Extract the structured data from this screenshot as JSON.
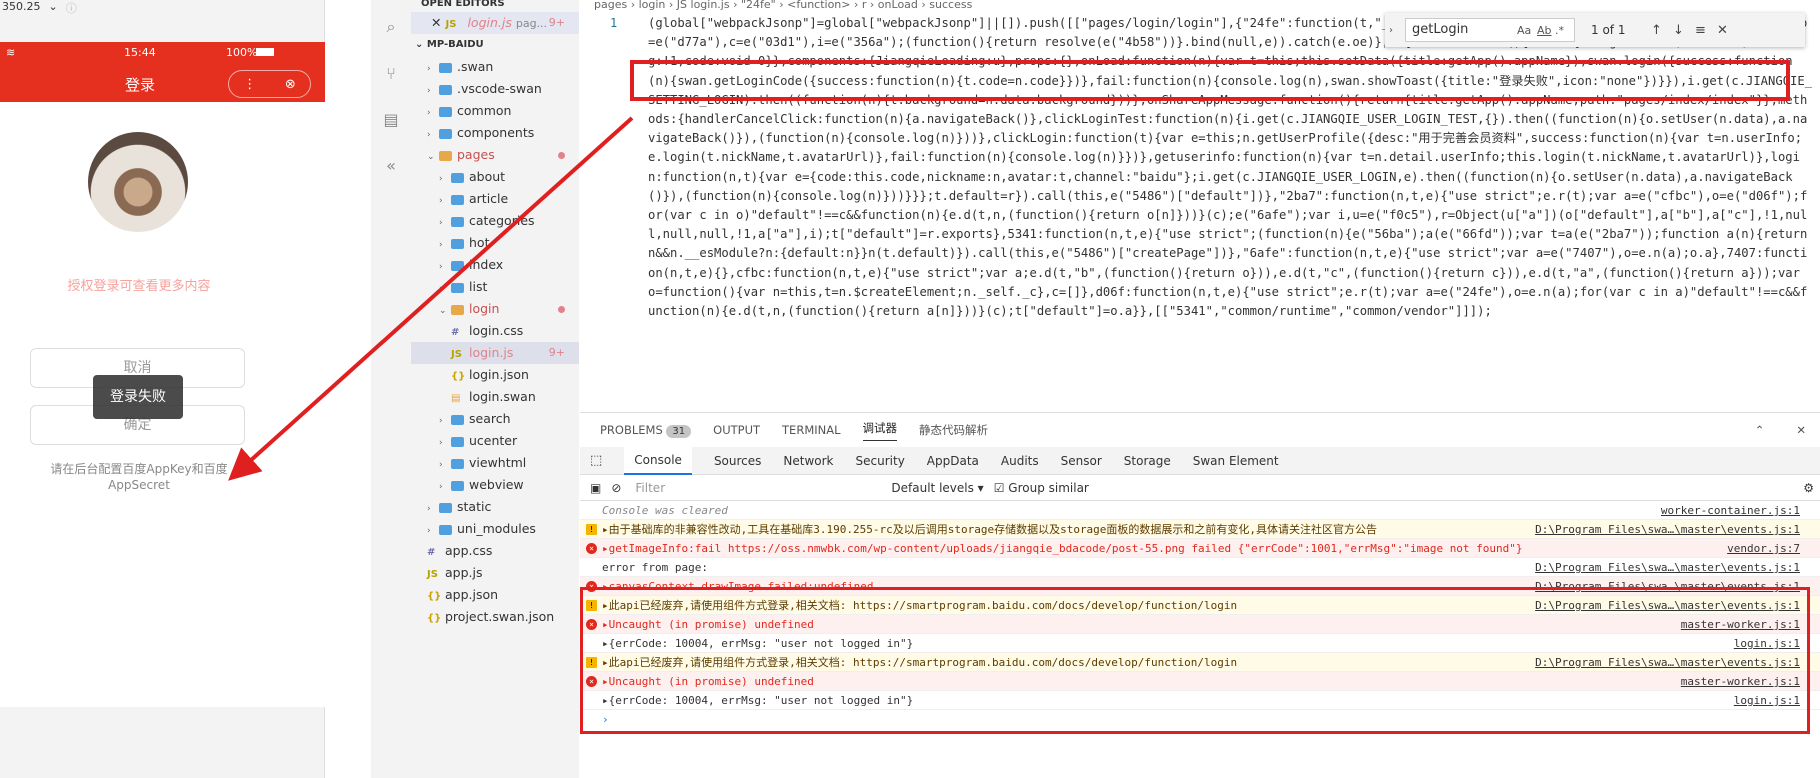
{
  "simulator": {
    "zoom": "350.25",
    "status_time": "15:44",
    "battery": "100%",
    "nav_title": "登录",
    "hint": "授权登录可查看更多内容",
    "cancel_label": "取消",
    "confirm_label": "确定",
    "toast": "登录失败",
    "footer": "请在后台配置百度AppKey和百度AppSecret"
  },
  "explorer": {
    "open_editors_label": "OPEN EDITORS",
    "open_file": "login.js",
    "open_file_path": "pag...",
    "open_file_badge": "9+",
    "project": "MP-BAIDU",
    "items": [
      ".swan",
      ".vscode-swan",
      "common",
      "components",
      "pages",
      "about",
      "article",
      "categories",
      "hot",
      "index",
      "list",
      "login",
      "login.css",
      "login.js",
      "login.json",
      "login.swan",
      "search",
      "ucenter",
      "viewhtml",
      "webview",
      "static",
      "uni_modules",
      "app.css",
      "app.js",
      "app.json",
      "project.swan.json"
    ],
    "login_js_badge": "9+"
  },
  "editor": {
    "breadcrumb": "pages › login › JS login.js › \"24fe\" › <function> › r › onLoad › success",
    "line_number": "1",
    "code": "(global[\"webpackJsonp\"]=global[\"webpackJsonp\"]||[]).push([[\"pages/login/login\"],{\"24fe\":function(t,\"__esModule\",{value:!0}),t.default=void 0;var a=e(\"a81a\"),o=e(\"d77a\"),c=e(\"03d1\"),i=e(\"356a\");(function(){return resolve(e(\"4b58\"))}.bind(null,e)).catch(e.oe)},r={data:function(){return{background:\"\",title:\"\",loading:!1,code:void 0}},components:{JiangqieLoading:u},props:{},onLoad:function(n){var t=this;this.setData({title:getApp().appName}),swan.login({success:function(n){swan.getLoginCode({success:function(n){t.code=n.code}})},fail:function(n){console.log(n),swan.showToast({title:\"登录失败\",icon:\"none\"})}}),i.get(c.JIANGQIE_SETTING_LOGIN).then((function(n){t.background=n.data.background}))},onShareAppMessage:function(){return{title:getApp().appName,path:\"pages/index/index\"}},methods:{handlerCancelClick:function(n){a.navigateBack()},clickLoginTest:function(n){i.get(c.JIANGQIE_USER_LOGIN_TEST,{}).then((function(n){o.setUser(n.data),a.navigateBack()}),(function(n){console.log(n)}))},clickLogin:function(t){var e=this;n.getUserProfile({desc:\"用于完善会员资料\",success:function(n){var t=n.userInfo;e.login(t.nickName,t.avatarUrl)},fail:function(n){console.log(n)}})},getuserinfo:function(n){var t=n.detail.userInfo;this.login(t.nickName,t.avatarUrl)},login:function(n,t){var e={code:this.code,nickname:n,avatar:t,channel:\"baidu\"};i.get(c.JIANGQIE_USER_LOGIN,e).then((function(n){o.setUser(n.data),a.navigateBack()}),(function(n){console.log(n)}))}}};t.default=r}).call(this,e(\"5486\")[\"default\"])},\"2ba7\":function(n,t,e){\"use strict\";e.r(t);var a=e(\"cfbc\"),o=e(\"d06f\");for(var c in o)\"default\"!==c&&function(n){e.d(t,n,(function(){return o[n]}))}(c);e(\"6afe\");var i,u=e(\"f0c5\"),r=Object(u[\"a\"])(o[\"default\"],a[\"b\"],a[\"c\"],!1,null,null,null,!1,a[\"a\"],i);t[\"default\"]=r.exports},5341:function(n,t,e){\"use strict\";(function(n){e(\"56ba\");a(e(\"66fd\"));var t=a(e(\"2ba7\"));function a(n){return n&&n.__esModule?n:{default:n}}n(t.default)}).call(this,e(\"5486\")[\"createPage\"])},\"6afe\":function(n,t,e){\"use strict\";var a=e(\"7407\"),o=e.n(a);o.a},7407:function(n,t,e){},cfbc:function(n,t,e){\"use strict\";var a;e.d(t,\"b\",(function(){return o})),e.d(t,\"c\",(function(){return c})),e.d(t,\"a\",(function(){return a}));var o=function(){var n=this,t=n.$createElement;n._self._c},c=[]},d06f:function(n,t,e){\"use strict\";e.r(t);var a=e(\"24fe\"),o=e.n(a);for(var c in a)\"default\"!==c&&function(n){e.d(t,n,(function(){return a[n]}))}(c);t[\"default\"]=o.a}},[[\"5341\",\"common/runtime\",\"common/vendor\"]]]);"
  },
  "find": {
    "query": "getLogin",
    "count": "1 of 1",
    "opt_case": "Aa",
    "opt_word": "Ab",
    "opt_regex": ".*"
  },
  "panel": {
    "tabs": [
      "PROBLEMS",
      "OUTPUT",
      "TERMINAL",
      "调试器",
      "静态代码解析"
    ],
    "problems_count": "31"
  },
  "devtools": {
    "tabs": [
      "Console",
      "Sources",
      "Network",
      "Security",
      "AppData",
      "Audits",
      "Sensor",
      "Storage",
      "Swan Element"
    ],
    "filter_placeholder": "Filter",
    "levels": "Default levels ▾",
    "group_similar": "Group similar"
  },
  "console": [
    {
      "type": "info",
      "text": "Console was cleared",
      "src": "worker-container.js:1"
    },
    {
      "type": "warn",
      "text": "▸由于基础库的非兼容性改动,工具在基础库3.190.255-rc及以后调用storage存储数据以及storage面板的数据展示和之前有变化,具体请关注社区官方公告",
      "src": "D:\\Program Files\\swa…\\master\\events.js:1"
    },
    {
      "type": "err",
      "text": "▸getImageInfo:fail https://oss.nmwbk.com/wp-content/uploads/jiangqie_bdacode/post-55.png failed {\"errCode\":1001,\"errMsg\":\"image not found\"}",
      "src": "vendor.js:7"
    },
    {
      "type": "info",
      "text": "error from page:",
      "src": "D:\\Program Files\\swa…\\master\\events.js:1"
    },
    {
      "type": "err",
      "text": "▸canvasContext.drawImage failed:undefined",
      "src": "D:\\Program Files\\swa…\\master\\events.js:1"
    },
    {
      "type": "warn",
      "text": "▸此api已经废弃,请使用组件方式登录,相关文档: https://smartprogram.baidu.com/docs/develop/function/login",
      "src": "D:\\Program Files\\swa…\\master\\events.js:1"
    },
    {
      "type": "err",
      "text": "▸Uncaught (in promise) undefined",
      "src": "master-worker.js:1"
    },
    {
      "type": "info",
      "text": "▸{errCode: 10004, errMsg: \"user not logged in\"}",
      "src": "login.js:1"
    },
    {
      "type": "warn",
      "text": "▸此api已经废弃,请使用组件方式登录,相关文档: https://smartprogram.baidu.com/docs/develop/function/login",
      "src": "D:\\Program Files\\swa…\\master\\events.js:1"
    },
    {
      "type": "err",
      "text": "▸Uncaught (in promise) undefined",
      "src": "master-worker.js:1"
    },
    {
      "type": "info",
      "text": "▸{errCode: 10004, errMsg: \"user not logged in\"}",
      "src": "login.js:1"
    }
  ],
  "colors": {
    "accent_red": "#e5301f",
    "annotation_red": "#e02020"
  }
}
